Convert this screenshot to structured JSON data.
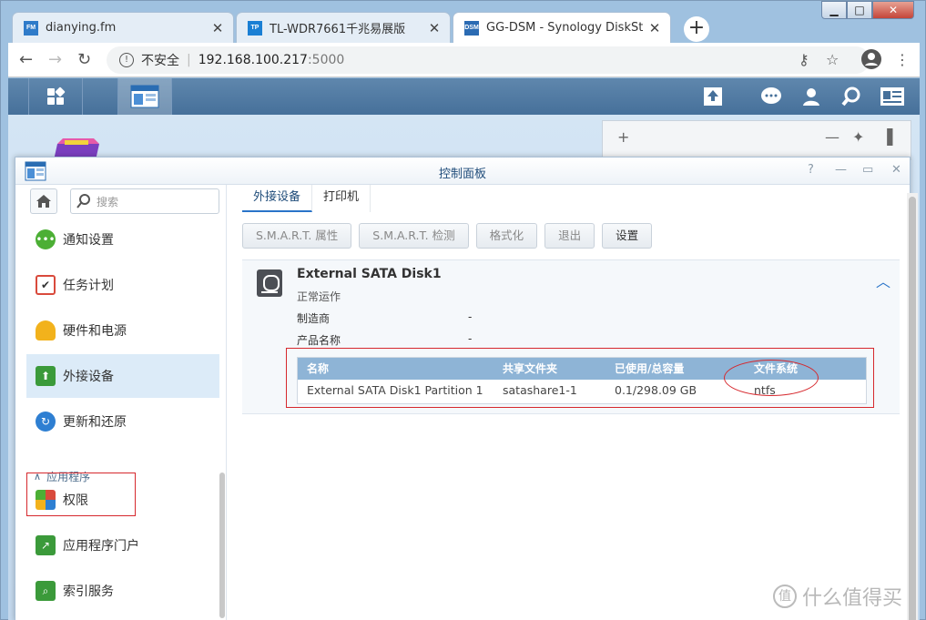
{
  "browser": {
    "tabs": [
      {
        "label": "dianying.fm",
        "favicon": "FM"
      },
      {
        "label": "TL-WDR7661千兆易展版",
        "favicon": "TP"
      },
      {
        "label": "GG-DSM - Synology DiskStatio",
        "favicon": "DSM"
      }
    ],
    "address": {
      "security": "不安全",
      "host": "192.168.100.217",
      "port": ":5000"
    }
  },
  "window": {
    "title": "控制面板"
  },
  "sidebar": {
    "search_placeholder": "搜索",
    "items": [
      {
        "label": "通知设置",
        "icon": "chat-bubble-icon",
        "color": "#4caf35"
      },
      {
        "label": "任务计划",
        "icon": "calendar-check-icon",
        "color": "#d94a3c"
      },
      {
        "label": "硬件和电源",
        "icon": "lightbulb-icon",
        "color": "#f2b21c"
      },
      {
        "label": "外接设备",
        "icon": "upload-device-icon",
        "color": "#3b9a3a"
      },
      {
        "label": "更新和还原",
        "icon": "refresh-icon",
        "color": "#2e7fd2"
      }
    ],
    "group_label": "应用程序",
    "app_items": [
      {
        "label": "权限",
        "icon": "grid-squares-icon"
      },
      {
        "label": "应用程序门户",
        "icon": "portal-arrow-icon"
      },
      {
        "label": "索引服务",
        "icon": "search-index-icon"
      }
    ]
  },
  "main": {
    "tabs": [
      "外接设备",
      "打印机"
    ],
    "toolbar": [
      "S.M.A.R.T. 属性",
      "S.M.A.R.T. 检测",
      "格式化",
      "退出",
      "设置"
    ],
    "disk": {
      "name": "External SATA Disk1",
      "status": "正常运作",
      "fields": [
        {
          "label": "制造商",
          "value": "-"
        },
        {
          "label": "产品名称",
          "value": "-"
        }
      ],
      "columns": [
        "名称",
        "共享文件夹",
        "已使用/总容量",
        "文件系统"
      ],
      "rows": [
        [
          "External SATA Disk1 Partition 1",
          "satashare1-1",
          "0.1/298.09 GB",
          "ntfs"
        ]
      ]
    }
  },
  "watermark": "什么值得买"
}
